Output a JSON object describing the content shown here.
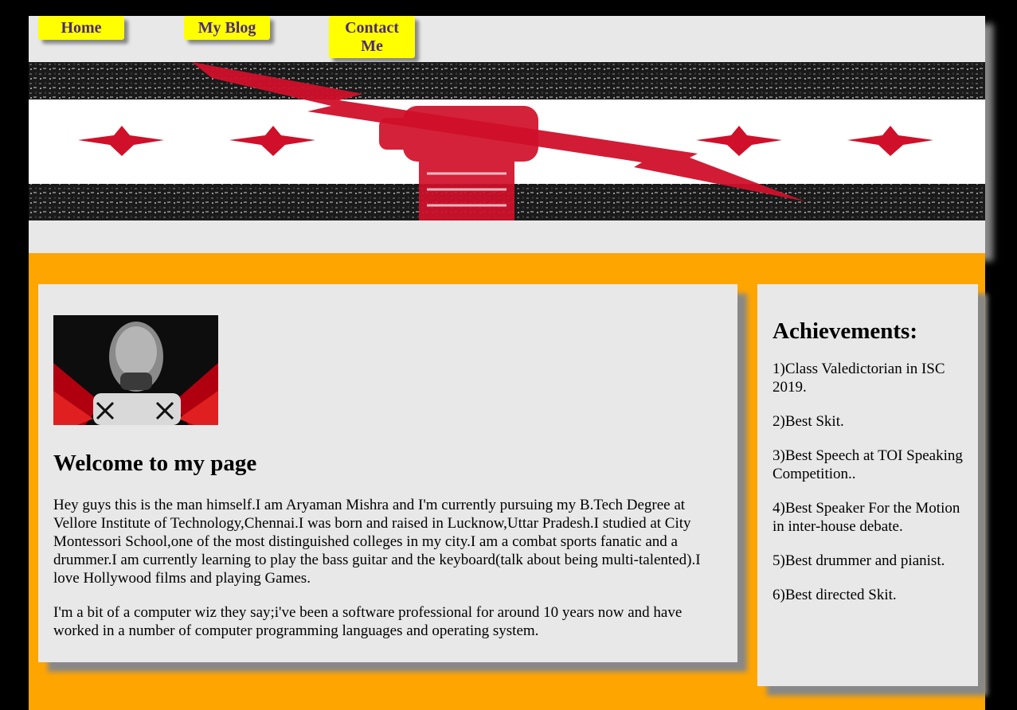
{
  "nav": {
    "home": "Home",
    "blog": "My Blog",
    "contact": "Contact Me"
  },
  "colors": {
    "page_bg": "#000000",
    "panel_bg": "#e8e8e8",
    "accent_orange": "#ffa500",
    "nav_button_bg": "#ffff00",
    "nav_button_text": "#4b2a7b",
    "banner_red": "#d0102a"
  },
  "banner": {
    "icon": "fist-lightning-stars-banner"
  },
  "main": {
    "profile_image": "profile-portrait-image",
    "title": "Welcome to my page",
    "paragraphs": [
      "Hey guys this is the man himself.I am Aryaman Mishra and I'm currently pursuing my B.Tech Degree at Vellore Institute of Technology,Chennai.I was born and raised in Lucknow,Uttar Pradesh.I studied at City Montessori School,one of the most distinguished colleges in my city.I am a combat sports fanatic and a drummer.I am currently learning to play the bass guitar and the keyboard(talk about being multi-talented).I love Hollywood films and playing Games.",
      "I'm a bit of a computer wiz they say;i've been a software professional for around 10 years now and have worked in a number of computer programming languages and operating system."
    ]
  },
  "sidebar": {
    "title": "Achievements:",
    "items": [
      "1)Class Valedictorian in ISC 2019.",
      "2)Best Skit.",
      "3)Best Speech at TOI Speaking Competition..",
      "4)Best Speaker For the Motion in inter-house debate.",
      "5)Best drummer and pianist.",
      "6)Best directed Skit."
    ]
  }
}
